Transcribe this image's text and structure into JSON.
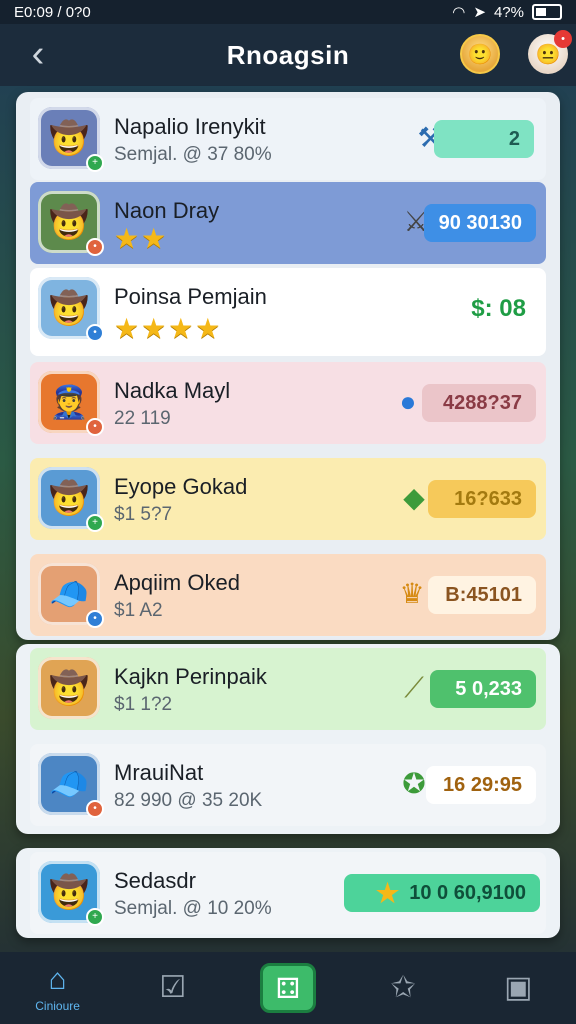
{
  "status": {
    "time": "E0:09 / 0?0",
    "battery": "4?%"
  },
  "header": {
    "title": "Rnoagsin"
  },
  "rows": [
    {
      "name": "Napalio Irenykit",
      "sub": "Semjal. @ 37 80%",
      "value": "2"
    },
    {
      "name": "Naon Dray",
      "stars": "★★",
      "value": "90 30130"
    },
    {
      "name": "Poinsa Pemjain",
      "stars": "★★★★",
      "value": "$: 08"
    },
    {
      "name": "Nadka Mayl",
      "sub": "22 119",
      "value": "4288?37"
    },
    {
      "name": "Eyope Gokad",
      "sub": "$1 5?7",
      "value": "16?633"
    },
    {
      "name": "Apqiim Oked",
      "sub": "$1 A2",
      "value": "B:45101"
    }
  ],
  "rows2": [
    {
      "name": "Kajkn Perinpaik",
      "sub": "$1 1?2",
      "value": "5 0,233"
    },
    {
      "name": "MrauiNat",
      "sub": "82 990  @ 35 20K",
      "value": "16 29:95"
    }
  ],
  "row3": {
    "name": "Sedasdr",
    "sub": "Semjal. @ 10 20%",
    "value": "10 0 60,9100"
  },
  "nav": {
    "home_label": "Cinioure"
  },
  "colors": {
    "accent": "#3dbb6a",
    "highlight_blue": "#6f8fd0"
  },
  "icons": [
    "back-arrow-icon",
    "home-icon",
    "tasks-icon",
    "dice-icon",
    "star-burst-icon",
    "profile-icon"
  ]
}
